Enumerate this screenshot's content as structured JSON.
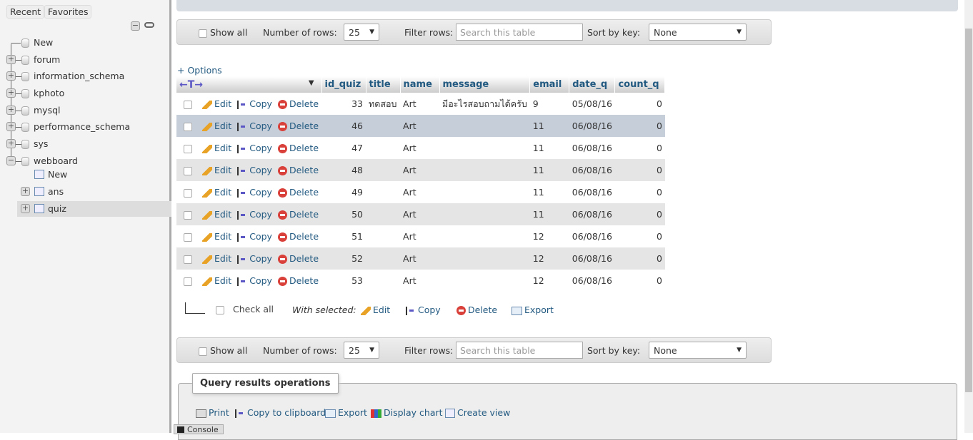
{
  "sidebar": {
    "recent": "Recent",
    "favorites": "Favorites",
    "tree": [
      {
        "label": "New",
        "kind": "new"
      },
      {
        "label": "forum"
      },
      {
        "label": "information_schema"
      },
      {
        "label": "kphoto"
      },
      {
        "label": "mysql"
      },
      {
        "label": "performance_schema"
      },
      {
        "label": "sys"
      },
      {
        "label": "webboard",
        "expanded": true
      }
    ],
    "webboard_children": [
      {
        "label": "New"
      },
      {
        "label": "ans"
      },
      {
        "label": "quiz",
        "selected": true
      }
    ]
  },
  "nav": {
    "show_all": "Show all",
    "num_rows_label": "Number of rows:",
    "num_rows": "25",
    "filter_label": "Filter rows:",
    "filter_placeholder": "Search this table",
    "sort_label": "Sort by key:",
    "sort_value": "None"
  },
  "options": "+ Options",
  "table": {
    "columns": [
      "id_quiz",
      "title",
      "name",
      "message",
      "email",
      "date_q",
      "count_q"
    ],
    "actions": {
      "edit": "Edit",
      "copy": "Copy",
      "delete": "Delete"
    },
    "rows": [
      [
        "33",
        "ทดสอบ",
        "Art",
        "มีอะไรสอบถามได้ครับ",
        "9",
        "05/08/16",
        "0"
      ],
      [
        "46",
        "",
        "Art",
        "",
        "11",
        "06/08/16",
        "0"
      ],
      [
        "47",
        "",
        "Art",
        "",
        "11",
        "06/08/16",
        "0"
      ],
      [
        "48",
        "",
        "Art",
        "",
        "11",
        "06/08/16",
        "0"
      ],
      [
        "49",
        "",
        "Art",
        "",
        "11",
        "06/08/16",
        "0"
      ],
      [
        "50",
        "",
        "Art",
        "",
        "11",
        "06/08/16",
        "0"
      ],
      [
        "51",
        "",
        "Art",
        "",
        "12",
        "06/08/16",
        "0"
      ],
      [
        "52",
        "",
        "Art",
        "",
        "12",
        "06/08/16",
        "0"
      ],
      [
        "53",
        "",
        "Art",
        "",
        "12",
        "06/08/16",
        "0"
      ]
    ]
  },
  "with_selected": {
    "check_all": "Check all",
    "label": "With selected:",
    "edit": "Edit",
    "copy": "Copy",
    "delete": "Delete",
    "export": "Export"
  },
  "ops": {
    "title": "Query results operations",
    "print": "Print",
    "copy": "Copy to clipboard",
    "export": "Export",
    "chart": "Display chart",
    "view": "Create view"
  },
  "console": "Console"
}
